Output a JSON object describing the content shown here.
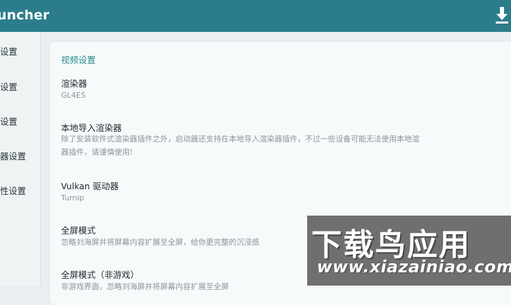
{
  "app_bar": {
    "title": "uncher",
    "download_icon": "download-icon",
    "background": "#2c7d8b"
  },
  "sidebar": {
    "items": [
      {
        "label": "设置"
      },
      {
        "label": "设置"
      },
      {
        "label": "设置"
      },
      {
        "label": "器设置"
      },
      {
        "label": "性设置"
      }
    ]
  },
  "settings": {
    "section_title": "视频设置",
    "items": [
      {
        "title": "渲染器",
        "subtitle": "GL4ES"
      },
      {
        "title": "本地导入渲染器",
        "subtitle": "除了安装软件式渲染器插件之外，启动器还支持在本地导入渲染器插件，不过一些设备可能无法使用本地渲",
        "subtitle2": "器插件，请谨慎使用!"
      },
      {
        "title": "Vulkan 驱动器",
        "subtitle": "Turnip"
      },
      {
        "title": "全屏模式",
        "subtitle": "忽略刘海屏并将屏幕内容扩展至全屏，给你更完整的沉浸感"
      },
      {
        "title": "全屏模式（非游戏）",
        "subtitle": "非游戏界面，忽略刘海屏并将屏幕内容扩展至全屏"
      }
    ]
  },
  "watermark": {
    "cn": "下载鸟应用",
    "url": "www.xiazainiao.com"
  }
}
